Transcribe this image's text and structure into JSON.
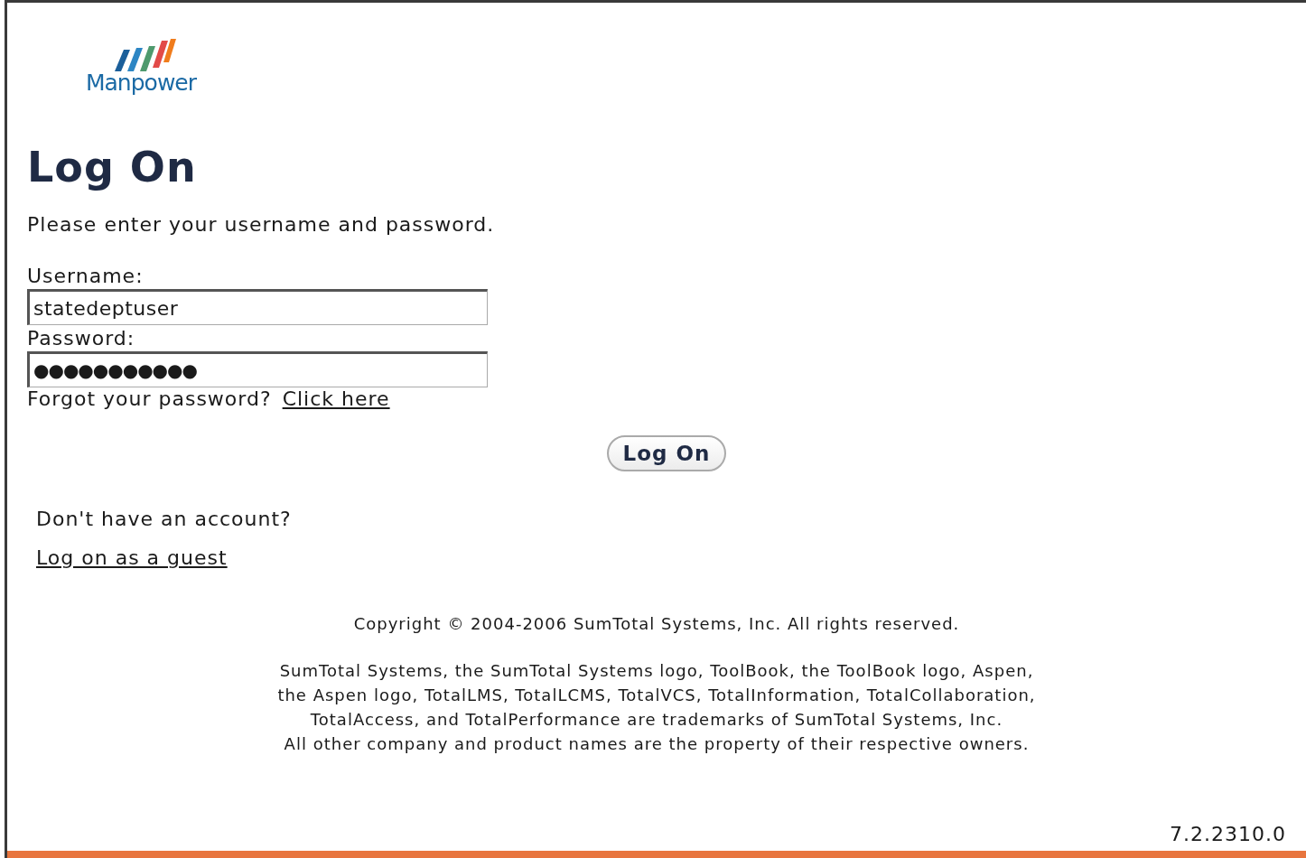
{
  "logo": {
    "text": "Manpower"
  },
  "heading": "Log On",
  "instructions": "Please enter your username and password.",
  "fields": [
    {
      "label": "Username:",
      "value": "statedeptuser"
    },
    {
      "label": "Password:",
      "value": "●●●●●●●●●●●"
    }
  ],
  "forgot": {
    "text": "Forgot your password?",
    "link": "Click here"
  },
  "button": "Log On",
  "guest": {
    "text": "Don't have an account?",
    "link": "Log on as a guest"
  },
  "copyright": "Copyright © 2004-2006 SumTotal Systems, Inc. All rights reserved.",
  "trademarks": [
    "SumTotal Systems, the SumTotal Systems logo, ToolBook, the ToolBook logo, Aspen,",
    "the Aspen logo, TotalLMS, TotalLCMS, TotalVCS, TotalInformation, TotalCollaboration,",
    "TotalAccess, and TotalPerformance are trademarks of SumTotal Systems, Inc.",
    "All other company and product names are the property of their respective owners."
  ],
  "version": "7.2.2310.0"
}
